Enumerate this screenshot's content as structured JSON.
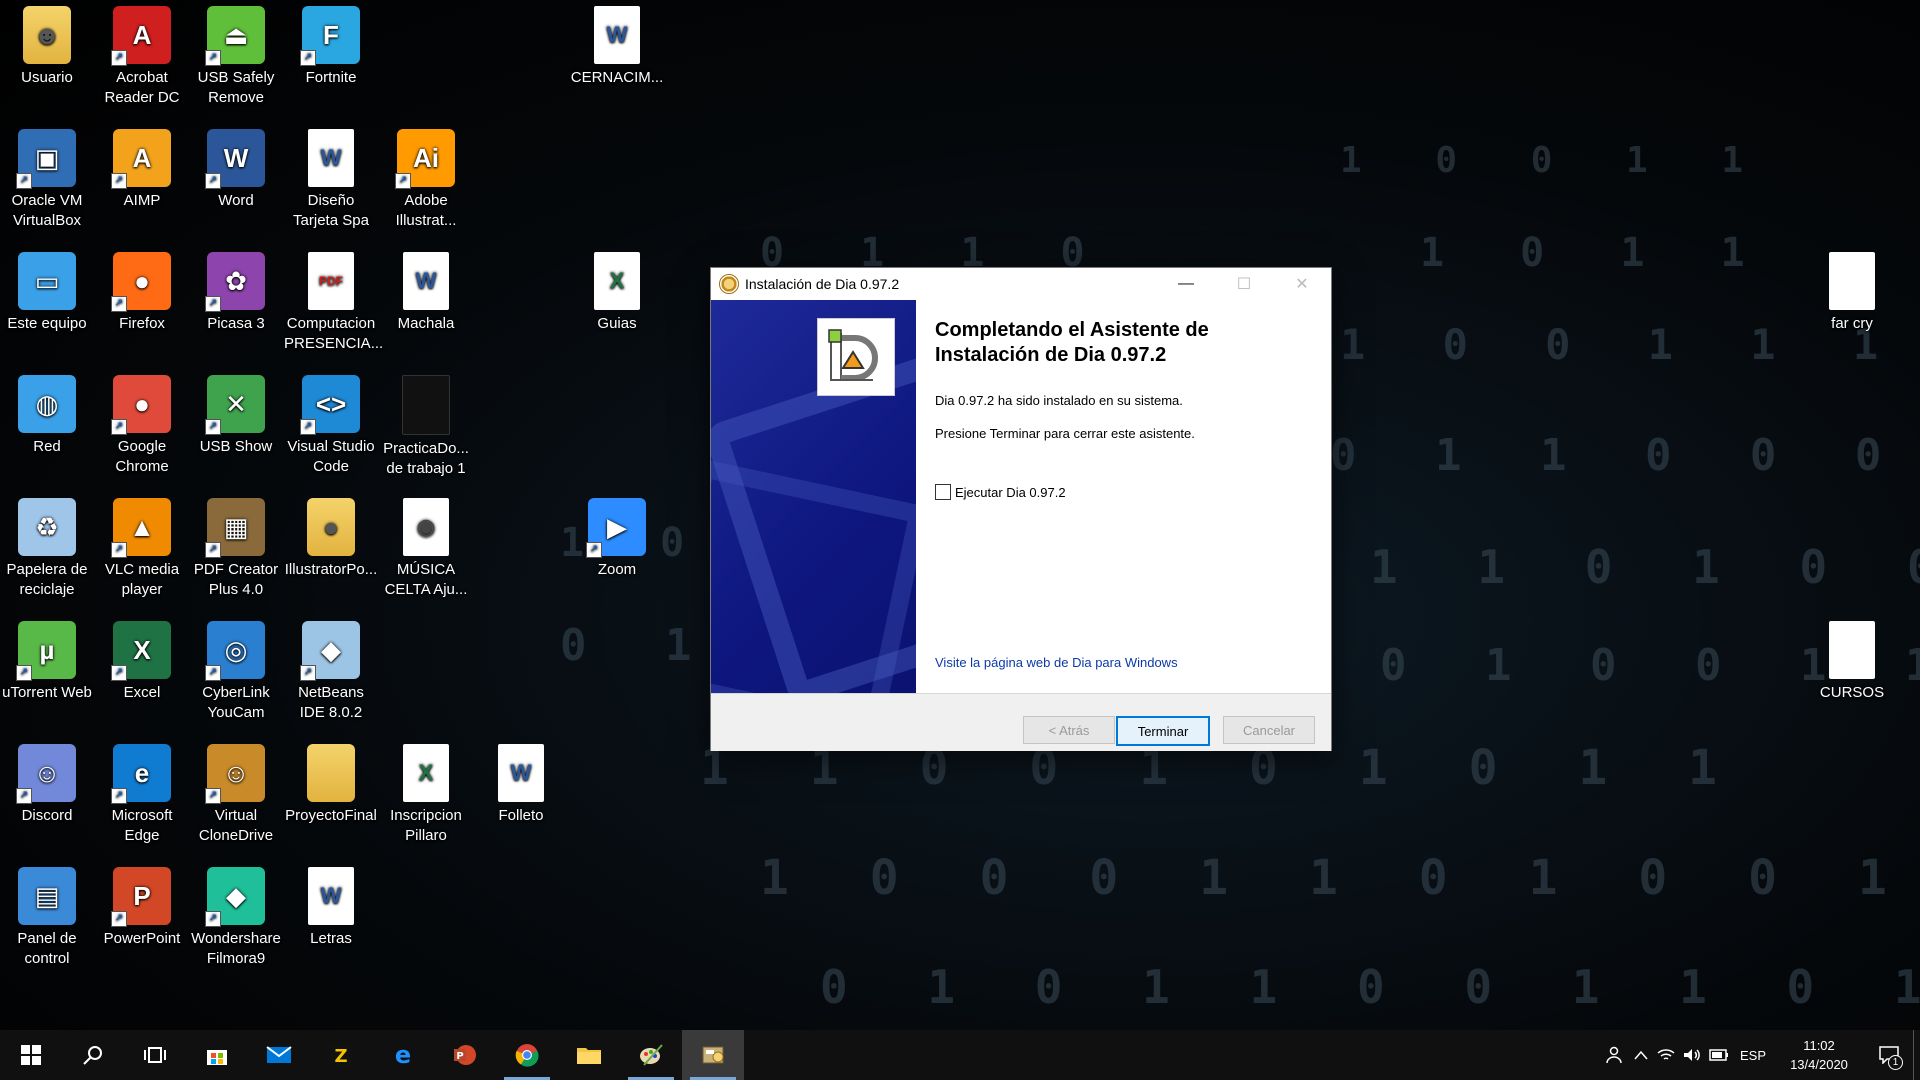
{
  "desktop_icons": [
    {
      "id": "usuario",
      "label": "Usuario",
      "icon": "user-folder-icon",
      "color": "#e8b84a"
    },
    {
      "id": "acrobat",
      "label": "Acrobat Reader DC",
      "icon": "acrobat-icon",
      "color": "#d01f1f"
    },
    {
      "id": "usbsafe",
      "label": "USB Safely Remove",
      "icon": "usb-safely-remove-icon",
      "color": "#5fbf3a"
    },
    {
      "id": "fortnite",
      "label": "Fortnite",
      "icon": "fortnite-icon",
      "color": "#2aa7e0"
    },
    {
      "id": "cernacim",
      "label": "CERNACIM...",
      "icon": "word-doc-icon",
      "color": "#2b579a"
    },
    {
      "id": "virtualbox",
      "label": "Oracle VM VirtualBox",
      "icon": "virtualbox-icon",
      "color": "#2f6db5"
    },
    {
      "id": "aimp",
      "label": "AIMP",
      "icon": "aimp-icon",
      "color": "#f3a21b"
    },
    {
      "id": "word",
      "label": "Word",
      "icon": "word-icon",
      "color": "#2b579a"
    },
    {
      "id": "disenio",
      "label": "Diseño Tarjeta Spa",
      "icon": "word-doc-icon",
      "color": "#2b579a"
    },
    {
      "id": "illustrator",
      "label": "Adobe Illustrat...",
      "icon": "illustrator-icon",
      "color": "#ff9a00"
    },
    {
      "id": "esteequipo",
      "label": "Este equipo",
      "icon": "this-pc-icon",
      "color": "#3aa0e8"
    },
    {
      "id": "firefox",
      "label": "Firefox",
      "icon": "firefox-icon",
      "color": "#ff6a14"
    },
    {
      "id": "picasa",
      "label": "Picasa 3",
      "icon": "picasa-icon",
      "color": "#8e44ad"
    },
    {
      "id": "computacion",
      "label": "Computacion PRESENCIA...",
      "icon": "pdf-doc-icon",
      "color": "#d01f1f"
    },
    {
      "id": "machala",
      "label": "Machala",
      "icon": "word-doc-icon",
      "color": "#2b579a"
    },
    {
      "id": "guias",
      "label": "Guias",
      "icon": "excel-doc-icon",
      "color": "#1f7244"
    },
    {
      "id": "farcry",
      "label": "far cry",
      "icon": "blank-file-icon",
      "color": "#e8e8e8"
    },
    {
      "id": "red",
      "label": "Red",
      "icon": "network-icon",
      "color": "#3aa0e8"
    },
    {
      "id": "chrome",
      "label": "Google Chrome",
      "icon": "chrome-icon",
      "color": "#e04a3a"
    },
    {
      "id": "usbshow",
      "label": "USB Show",
      "icon": "usb-show-icon",
      "color": "#3fa34d"
    },
    {
      "id": "vscode",
      "label": "Visual Studio Code",
      "icon": "vscode-icon",
      "color": "#1e8ad6"
    },
    {
      "id": "practica",
      "label": "PracticaDo... de trabajo 1",
      "icon": "file-icon",
      "color": "#222"
    },
    {
      "id": "zoom",
      "label": "Zoom",
      "icon": "zoom-icon",
      "color": "#2d8cff"
    },
    {
      "id": "papelera",
      "label": "Papelera de reciclaje",
      "icon": "recycle-bin-icon",
      "color": "#9fc6e8"
    },
    {
      "id": "vlc",
      "label": "VLC media player",
      "icon": "vlc-icon",
      "color": "#f08a00"
    },
    {
      "id": "pdfcreator",
      "label": "PDF Creator Plus 4.0",
      "icon": "pdf-creator-icon",
      "color": "#8a6a3a"
    },
    {
      "id": "illustratorpo",
      "label": "IllustratorPo...",
      "icon": "folder-chrome-icon",
      "color": "#e8c45a"
    },
    {
      "id": "musica",
      "label": "MÚSICA CELTA Aju...",
      "icon": "music-file-icon",
      "color": "#444"
    },
    {
      "id": "utorrent",
      "label": "uTorrent Web",
      "icon": "utorrent-icon",
      "color": "#58b848"
    },
    {
      "id": "excel",
      "label": "Excel",
      "icon": "excel-icon",
      "color": "#1f7244"
    },
    {
      "id": "cyberlink",
      "label": "CyberLink YouCam",
      "icon": "youcam-icon",
      "color": "#2a7fd0"
    },
    {
      "id": "netbeans",
      "label": "NetBeans IDE 8.0.2",
      "icon": "netbeans-icon",
      "color": "#9cc4e4"
    },
    {
      "id": "cursos",
      "label": "CURSOS",
      "icon": "blank-file-icon",
      "color": "#e8e8e8"
    },
    {
      "id": "discord",
      "label": "Discord",
      "icon": "discord-icon",
      "color": "#7289da"
    },
    {
      "id": "edge",
      "label": "Microsoft Edge",
      "icon": "edge-icon",
      "color": "#0f7bd1"
    },
    {
      "id": "clonedrive",
      "label": "Virtual CloneDrive",
      "icon": "clonedrive-icon",
      "color": "#c98a2a"
    },
    {
      "id": "proyecto",
      "label": "ProyectoFinal",
      "icon": "folder-icon",
      "color": "#e8c45a"
    },
    {
      "id": "inscripcion",
      "label": "Inscripcion Pillaro",
      "icon": "excel-doc-icon",
      "color": "#1f7244"
    },
    {
      "id": "folleto",
      "label": "Folleto",
      "icon": "word-doc-icon",
      "color": "#2b579a"
    },
    {
      "id": "panel",
      "label": "Panel de control",
      "icon": "control-panel-icon",
      "color": "#3a8ad8"
    },
    {
      "id": "powerpoint",
      "label": "PowerPoint",
      "icon": "powerpoint-icon",
      "color": "#d24726"
    },
    {
      "id": "filmora",
      "label": "Wondershare Filmora9",
      "icon": "filmora-icon",
      "color": "#1fbf9a"
    },
    {
      "id": "letras",
      "label": "Letras",
      "icon": "word-doc-icon",
      "color": "#2b579a"
    }
  ],
  "installer": {
    "title": "Instalación de Dia 0.97.2",
    "heading": "Completando el Asistente de Instalación de Dia 0.97.2",
    "installed_text": "Dia 0.97.2 ha sido instalado en su sistema.",
    "finish_text": "Presione Terminar para cerrar este asistente.",
    "run_checkbox_label": "Ejecutar Dia 0.97.2",
    "run_checked": false,
    "web_link": "Visite la página web de Dia para Windows",
    "back_label": "< Atrás",
    "finish_label": "Terminar",
    "cancel_label": "Cancelar"
  },
  "taskbar": {
    "items": [
      "start-icon",
      "search-icon",
      "task-view-icon",
      "store-icon",
      "mail-icon",
      "winzip-icon",
      "edge-icon",
      "powerpoint-icon",
      "chrome-icon",
      "file-explorer-icon",
      "paint-icon",
      "dia-installer-icon"
    ],
    "language": "ESP",
    "time": "11:02",
    "date": "13/4/2020",
    "notification_count": "1"
  }
}
